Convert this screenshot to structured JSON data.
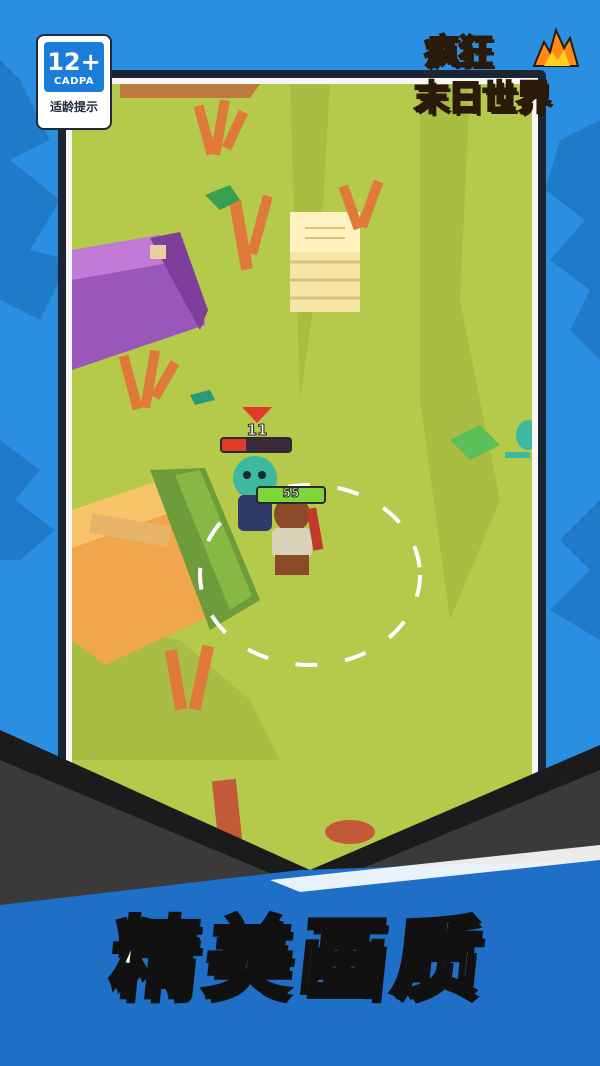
{
  "age_rating": {
    "number": "12+",
    "code": "CADPA",
    "note": "适龄提示"
  },
  "logo": {
    "line1": "疯狂",
    "line2": "末日世界"
  },
  "enemy": {
    "hp_value": "11",
    "hp_fraction": 0.35
  },
  "player": {
    "hp_value": "55",
    "hp_fraction": 1.0
  },
  "headline": "精美画质",
  "colors": {
    "background_blue": "#2a8fe0",
    "grass": "#b5c94a",
    "frame_border": "#1b2533",
    "logo_yellow": "#ffd21f",
    "hp_red": "#e23a2a",
    "hp_green": "#7dd63a"
  }
}
